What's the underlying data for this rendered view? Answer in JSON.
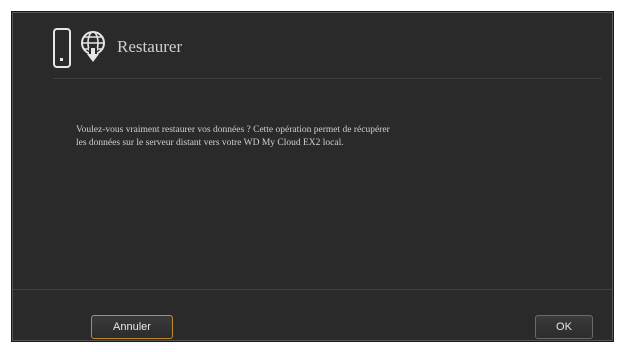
{
  "dialog": {
    "title": "Restaurer",
    "message_line1": "Voulez-vous vraiment restaurer vos données ? Cette opération permet de récupérer",
    "message_line2": "les données sur le serveur distant vers votre WD My Cloud EX2 local.",
    "cancel_label": "Annuler",
    "ok_label": "OK"
  },
  "icons": {
    "device": "nas-device-icon",
    "cloud": "globe-download-icon"
  },
  "colors": {
    "background": "#2a2a2a",
    "text": "#cfcfcf",
    "focus_border": "#c08a2a"
  }
}
